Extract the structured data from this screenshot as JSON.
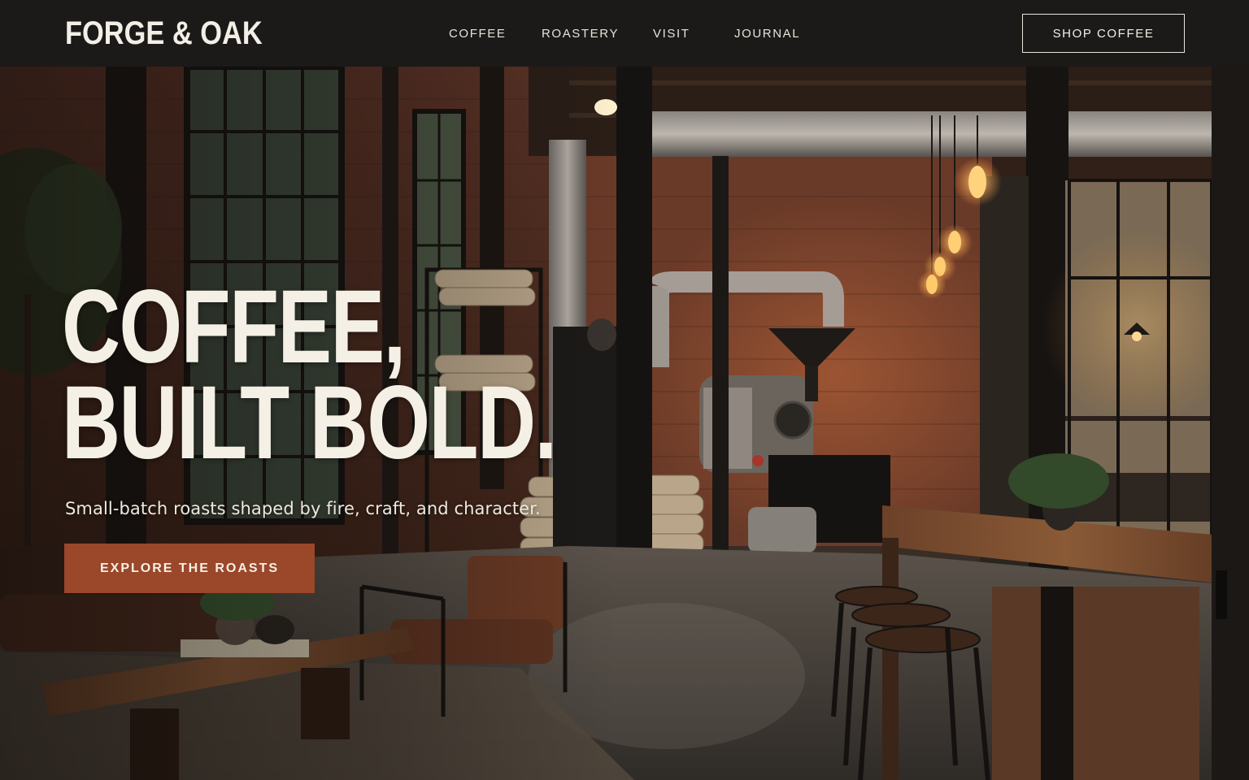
{
  "brand": {
    "logo_text": "FORGE & OAK"
  },
  "nav": {
    "links": [
      {
        "label": "COFFEE"
      },
      {
        "label": "ROASTERY"
      },
      {
        "label": "VISIT"
      },
      {
        "label": "JOURNAL"
      }
    ],
    "shop_label": "SHOP COFFEE"
  },
  "hero": {
    "headline_line1": "COFFEE,",
    "headline_line2": "BUILT BOLD.",
    "subhead": "Small-batch roasts shaped by fire, craft, and character.",
    "cta_label": "EXPLORE THE ROASTS",
    "image_description_icon": "industrial-cafe-roastery-photo"
  },
  "colors": {
    "nav_bg": "#1b1a19",
    "cta_bg": "#9a472a",
    "text_light": "#f4f0e6"
  }
}
